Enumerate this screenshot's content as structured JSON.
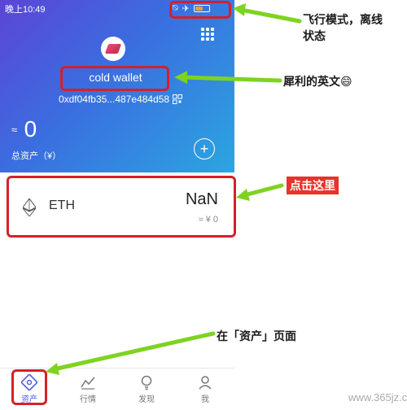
{
  "status_bar": {
    "time": "晚上10:49"
  },
  "wallet": {
    "name": "cold wallet",
    "address": "0xdf04fb35...487e484d58",
    "balance_approx_symbol": "≈",
    "balance": "0",
    "total_label": "总资产（¥）"
  },
  "tokens": [
    {
      "symbol": "ETH",
      "amount": "NaN",
      "fiat": "≈ ¥ 0"
    }
  ],
  "tabbar": {
    "items": [
      {
        "label": "资产",
        "icon": "assets-icon",
        "active": true
      },
      {
        "label": "行情",
        "icon": "market-chart-icon",
        "active": false
      },
      {
        "label": "发现",
        "icon": "discover-bulb-icon",
        "active": false
      },
      {
        "label": "我",
        "icon": "profile-icon",
        "active": false
      }
    ]
  },
  "annotations": {
    "offline": "飞行模式，离线状态",
    "wallet_name": "犀利的英文😄",
    "click_here": "点击这里",
    "assets_page": "在「资产」页面"
  },
  "watermark": "www.365jz.com",
  "colors": {
    "header_start": "#5b45d6",
    "header_end": "#2ba6e0",
    "annotation_box": "#d4202a",
    "annotation_arrow": "#7ed321",
    "active_tab": "#4a5ee8"
  }
}
